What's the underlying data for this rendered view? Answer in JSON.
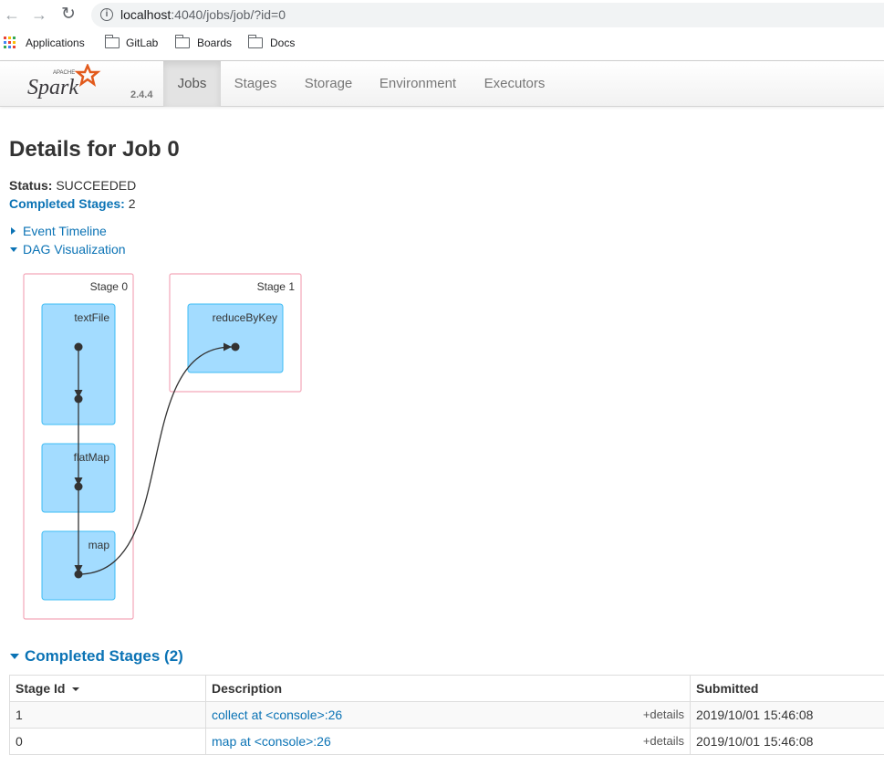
{
  "browser": {
    "url_host": "localhost",
    "url_path": ":4040/jobs/job/?id=0",
    "bookmarks": [
      "Applications",
      "GitLab",
      "Boards",
      "Docs"
    ]
  },
  "spark": {
    "logo_small": "APACHE",
    "logo_text": "Spark",
    "version": "2.4.4",
    "tabs": [
      "Jobs",
      "Stages",
      "Storage",
      "Environment",
      "Executors"
    ],
    "active_tab": "Jobs"
  },
  "page": {
    "title": "Details for Job 0",
    "status_label": "Status:",
    "status_value": "SUCCEEDED",
    "completed_label": "Completed Stages:",
    "completed_value": "2",
    "event_timeline": "Event Timeline",
    "dag_visualization": "DAG Visualization"
  },
  "dag": {
    "stages": [
      {
        "label": "Stage 0",
        "ops": [
          "textFile",
          "flatMap",
          "map"
        ]
      },
      {
        "label": "Stage 1",
        "ops": [
          "reduceByKey"
        ]
      }
    ]
  },
  "completed_stages": {
    "title": "Completed Stages (2)",
    "columns": [
      "Stage Id",
      "Description",
      "Submitted"
    ],
    "rows": [
      {
        "id": "1",
        "description": "collect at <console>:26",
        "details": "+details",
        "submitted": "2019/10/01 15:46:08"
      },
      {
        "id": "0",
        "description": "map at <console>:26",
        "details": "+details",
        "submitted": "2019/10/01 15:46:08"
      }
    ]
  },
  "colors": {
    "link": "#0b73b5",
    "stage_border": "#f4a7b9",
    "op_fill": "#a3dcff",
    "op_border": "#3ebcf4"
  }
}
